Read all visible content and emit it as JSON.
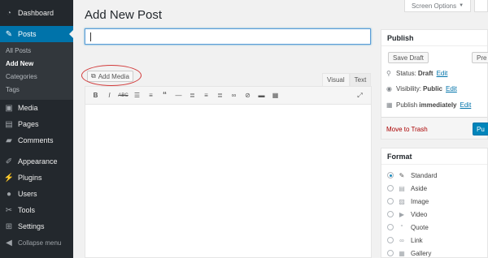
{
  "sidebar": {
    "items": [
      {
        "label": "Dashboard",
        "icon": "dashboard-icon"
      },
      {
        "label": "Posts",
        "icon": "pin-icon"
      },
      {
        "label": "Media",
        "icon": "media-icon"
      },
      {
        "label": "Pages",
        "icon": "pages-icon"
      },
      {
        "label": "Comments",
        "icon": "comments-icon"
      },
      {
        "label": "Appearance",
        "icon": "brush-icon"
      },
      {
        "label": "Plugins",
        "icon": "plugin-icon"
      },
      {
        "label": "Users",
        "icon": "users-icon"
      },
      {
        "label": "Tools",
        "icon": "wrench-icon"
      },
      {
        "label": "Settings",
        "icon": "settings-icon"
      },
      {
        "label": "Collapse menu",
        "icon": "collapse-icon"
      }
    ],
    "submenu": [
      "All Posts",
      "Add New",
      "Categories",
      "Tags"
    ]
  },
  "page_title": "Add New Post",
  "screen_options": "Screen Options",
  "add_media": "Add Media",
  "editor": {
    "tabs": [
      "Visual",
      "Text"
    ]
  },
  "publish": {
    "title": "Publish",
    "save_draft": "Save Draft",
    "preview": "Pre",
    "status_label": "Status:",
    "status_value": "Draft",
    "visibility_label": "Visibility:",
    "visibility_value": "Public",
    "publish_label": "Publish",
    "publish_value": "immediately",
    "edit": "Edit",
    "move_to_trash": "Move to Trash",
    "publish_button": "Pu"
  },
  "format": {
    "title": "Format",
    "options": [
      "Standard",
      "Aside",
      "Image",
      "Video",
      "Quote",
      "Link",
      "Gallery"
    ]
  },
  "colors": {
    "sidebar_bg": "#23282d",
    "accent": "#0073aa",
    "annotation": "#d23a3a"
  }
}
